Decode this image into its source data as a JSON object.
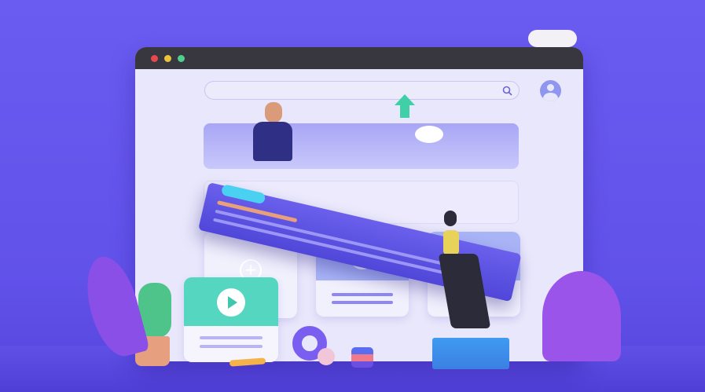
{
  "scene": {
    "window_controls": [
      {
        "name": "close",
        "color": "#e5484d"
      },
      {
        "name": "minimize",
        "color": "#e7c43c"
      },
      {
        "name": "maximize",
        "color": "#4fcf8e"
      }
    ],
    "icons": [
      "search-icon",
      "user-avatar-icon",
      "plus-icon",
      "play-icon",
      "arrow-up-icon"
    ],
    "colors": {
      "background": "#6a5cf0",
      "titlebar": "#38363f",
      "window": "#e9e7fb",
      "accent_teal": "#3fd0b8",
      "accent_blue": "#5046d8"
    }
  }
}
